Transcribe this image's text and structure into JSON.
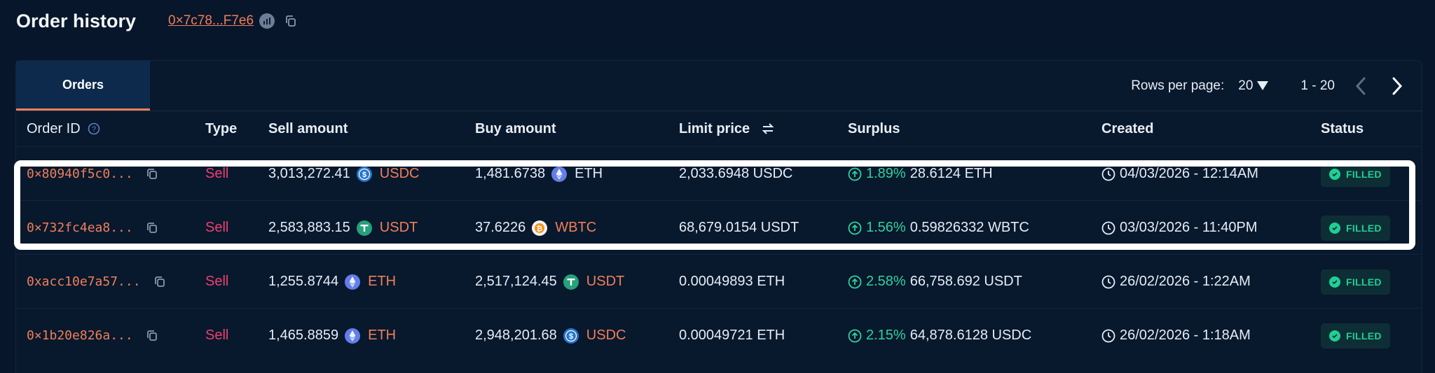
{
  "header": {
    "title": "Order history",
    "address": "0×7c78...F7e6"
  },
  "tabs": [
    {
      "label": "Orders",
      "active": true
    }
  ],
  "pagination": {
    "rows_per_page_label": "Rows per page:",
    "rows_per_page": "20",
    "range": "1 - 20"
  },
  "columns": {
    "order_id": "Order ID",
    "type": "Type",
    "sell_amount": "Sell amount",
    "buy_amount": "Buy amount",
    "limit_price": "Limit price",
    "surplus": "Surplus",
    "created": "Created",
    "status": "Status"
  },
  "orders": [
    {
      "id": "0×80940f5c0...",
      "type": "Sell",
      "sell_amount": "3,013,272.41",
      "sell_token": "USDC",
      "buy_amount": "1,481.6738",
      "buy_token": "ETH",
      "limit_price": "2,033.6948 USDC",
      "surplus_pct": "1.89%",
      "surplus_amount": "28.6124 ETH",
      "created": "04/03/2026 - 12:14AM",
      "status": "FILLED"
    },
    {
      "id": "0×732fc4ea8...",
      "type": "Sell",
      "sell_amount": "2,583,883.15",
      "sell_token": "USDT",
      "buy_amount": "37.6226",
      "buy_token": "WBTC",
      "limit_price": "68,679.0154 USDT",
      "surplus_pct": "1.56%",
      "surplus_amount": "0.59826332 WBTC",
      "created": "03/03/2026 - 11:40PM",
      "status": "FILLED"
    },
    {
      "id": "0xacc10e7a57...",
      "type": "Sell",
      "sell_amount": "1,255.8744",
      "sell_token": "ETH",
      "buy_amount": "2,517,124.45",
      "buy_token": "USDT",
      "limit_price": "0.00049893 ETH",
      "surplus_pct": "2.58%",
      "surplus_amount": "66,758.692 USDT",
      "created": "26/02/2026 - 1:22AM",
      "status": "FILLED"
    },
    {
      "id": "0×1b20e826a...",
      "type": "Sell",
      "sell_amount": "1,465.8859",
      "sell_token": "ETH",
      "buy_amount": "2,948,201.68",
      "buy_token": "USDC",
      "limit_price": "0.00049721 ETH",
      "surplus_pct": "2.15%",
      "surplus_amount": "64,878.6128 USDC",
      "created": "26/02/2026 - 1:18AM",
      "status": "FILLED"
    }
  ],
  "colors": {
    "background": "#07162a",
    "accent": "#f07f5a",
    "sell": "#ef3f6f",
    "positive": "#2dd39e",
    "tab_active": "#0d2a4d"
  }
}
